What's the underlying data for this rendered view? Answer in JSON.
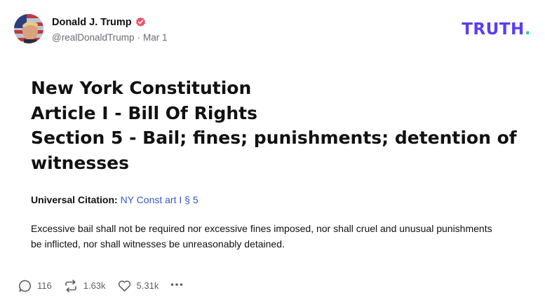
{
  "author": {
    "display_name": "Donald J. Trump",
    "handle": "@realDonaldTrump",
    "date": "Mar 1",
    "separator": "·",
    "verified": true
  },
  "brand": {
    "name": "TRUTH",
    "dot": ".",
    "color": "#5b3df5",
    "dot_color": "#1dd6b8"
  },
  "post": {
    "heading_lines": [
      "New York Constitution",
      "Article I - Bill Of Rights",
      "Section 5 - Bail; fines; punishments; detention of witnesses"
    ],
    "citation_label": "Universal Citation:",
    "citation_link": "NY Const art I § 5",
    "body": "Excessive bail shall not be required nor excessive fines imposed, nor shall cruel and unusual punishments be inflicted, nor shall witnesses be unreasonably detained."
  },
  "actions": {
    "replies": "116",
    "retruths": "1.63k",
    "likes": "5.31k"
  },
  "icons": [
    "verified-badge-icon",
    "reply-icon",
    "retruth-icon",
    "like-icon",
    "more-icon"
  ],
  "colors": {
    "link": "#3a57c4",
    "verified": "#e8556b",
    "muted": "#6b6b78"
  }
}
